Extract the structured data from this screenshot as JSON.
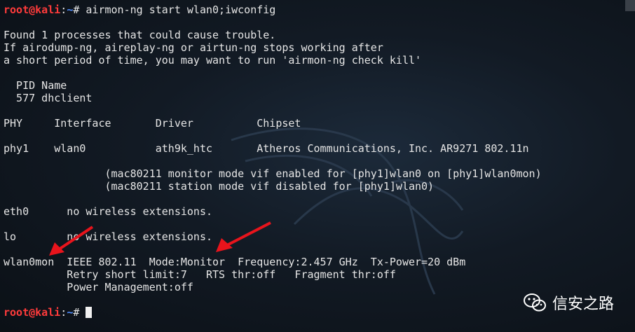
{
  "prompt": {
    "user": "root@kali",
    "sep": ":",
    "path": "~",
    "symbol": "# "
  },
  "command": "airmon-ng start wlan0;iwconfig",
  "output": [
    "",
    "Found 1 processes that could cause trouble.",
    "If airodump-ng, aireplay-ng or airtun-ng stops working after",
    "a short period of time, you may want to run 'airmon-ng check kill'",
    "",
    "  PID Name",
    "  577 dhclient",
    "",
    "PHY     Interface       Driver          Chipset",
    "",
    "phy1    wlan0           ath9k_htc       Atheros Communications, Inc. AR9271 802.11n",
    "",
    "                (mac80211 monitor mode vif enabled for [phy1]wlan0 on [phy1]wlan0mon)",
    "                (mac80211 station mode vif disabled for [phy1]wlan0)",
    "",
    "eth0      no wireless extensions.",
    "",
    "lo        no wireless extensions.",
    "",
    "wlan0mon  IEEE 802.11  Mode:Monitor  Frequency:2.457 GHz  Tx-Power=20 dBm",
    "          Retry short limit:7   RTS thr:off   Fragment thr:off",
    "          Power Management:off",
    ""
  ],
  "watermark": "信安之路",
  "colors": {
    "prompt_user": "#ff3b3b",
    "prompt_path": "#4f8dff",
    "arrow": "#e8141c"
  }
}
